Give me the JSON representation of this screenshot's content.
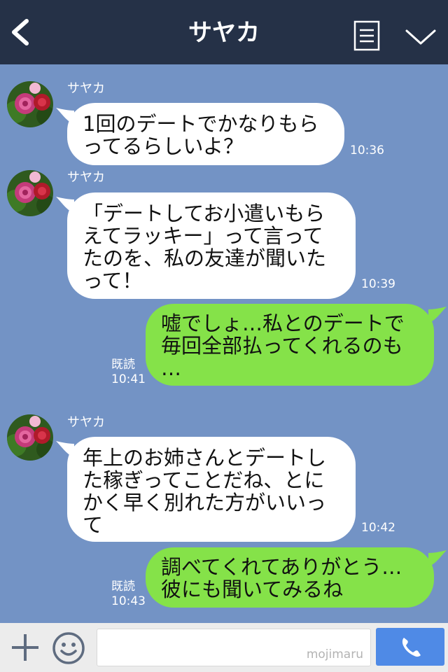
{
  "header": {
    "title": "サヤカ"
  },
  "messages": [
    {
      "direction": "in",
      "sender": "サヤカ",
      "text": "1回のデートでかなりもら\nってるらしいよ？",
      "time": "10:36"
    },
    {
      "direction": "in",
      "sender": "サヤカ",
      "text": "「デートしてお小遣いもら\nえてラッキー」って言って\nたのを、私の友達が聞いた\nって！",
      "time": "10:39"
    },
    {
      "direction": "out",
      "text": "嘘でしょ…私とのデートで\n毎回全部払ってくれるのも\n…",
      "read": "既読",
      "time": "10:41"
    },
    {
      "direction": "in",
      "sender": "サヤカ",
      "text": "年上のお姉さんとデートし\nた稼ぎってことだね、とに\nかく早く別れた方がいいっ\nて",
      "time": "10:42"
    },
    {
      "direction": "out",
      "text": "調べてくれてありがとう…\n彼にも聞いてみるね",
      "read": "既読",
      "time": "10:43"
    }
  ],
  "footer": {
    "watermark": "mojimaru"
  },
  "colors": {
    "header_bg": "#253147",
    "chat_bg": "#7393c5",
    "incoming_bubble": "#ffffff",
    "outgoing_bubble": "#85e249",
    "call_button": "#4f8ae6"
  },
  "icons": {
    "back": "chevron-left-icon",
    "menu": "menu-icon",
    "collapse": "chevron-down-icon",
    "avatar": "rose-avatar",
    "add": "plus-icon",
    "sticker": "smile-icon",
    "call": "phone-icon"
  }
}
